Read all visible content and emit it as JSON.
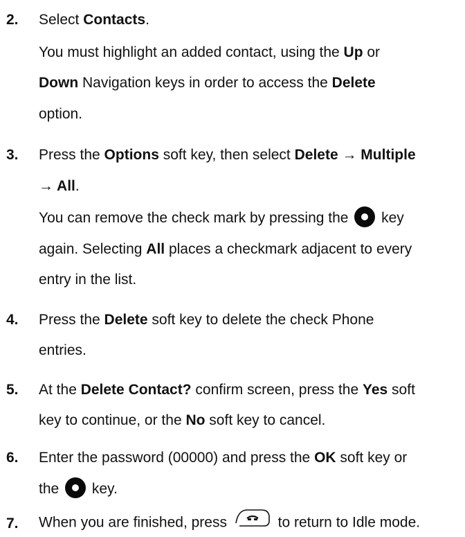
{
  "steps": [
    {
      "number": "2.",
      "lines": [
        [
          {
            "t": "Select "
          },
          {
            "t": "Contacts",
            "b": true
          },
          {
            "t": "."
          }
        ],
        [
          {
            "t": "You must highlight an added contact, using the "
          },
          {
            "t": "Up",
            "b": true
          },
          {
            "t": " or"
          }
        ],
        [
          {
            "t": "Down",
            "b": true
          },
          {
            "t": " Navigation keys in order to access the "
          },
          {
            "t": "Delete",
            "b": true
          }
        ],
        [
          {
            "t": "option."
          }
        ]
      ]
    },
    {
      "number": "3.",
      "lines": [
        [
          {
            "t": "Press the "
          },
          {
            "t": "Options",
            "b": true
          },
          {
            "t": " soft key, then select "
          },
          {
            "t": "Delete →  Multiple",
            "b": true
          }
        ],
        [
          {
            "t": "→ All",
            "b": true
          },
          {
            "t": "."
          }
        ],
        [
          {
            "t": "You can remove the check mark by pressing the "
          },
          {
            "icon": "ok-key-icon"
          },
          {
            "t": " key"
          }
        ],
        [
          {
            "t": "again. Selecting "
          },
          {
            "t": "All",
            "b": true
          },
          {
            "t": " places a checkmark adjacent to every"
          }
        ],
        [
          {
            "t": "entry in the list."
          }
        ]
      ]
    },
    {
      "number": "4.",
      "lines": [
        [
          {
            "t": "Press the "
          },
          {
            "t": "Delete",
            "b": true
          },
          {
            "t": " soft key to delete the check Phone"
          }
        ],
        [
          {
            "t": "entries."
          }
        ]
      ]
    },
    {
      "number": "5.",
      "lines": [
        [
          {
            "t": "At the "
          },
          {
            "t": "Delete Contact?",
            "b": true
          },
          {
            "t": " confirm screen, press the "
          },
          {
            "t": "Yes",
            "b": true
          },
          {
            "t": " soft"
          }
        ],
        [
          {
            "t": "key to continue, or the "
          },
          {
            "t": "No",
            "b": true
          },
          {
            "t": " soft key to cancel."
          }
        ]
      ]
    },
    {
      "number": "6.",
      "lines": [
        [
          {
            "t": "Enter the password (00000) and press the "
          },
          {
            "t": "OK",
            "b": true
          },
          {
            "t": " soft key or"
          }
        ],
        [
          {
            "t": "the "
          },
          {
            "icon": "ok-key-icon"
          },
          {
            "t": " key."
          }
        ]
      ]
    },
    {
      "number": "7.",
      "lines": [
        [
          {
            "t": "When you are finished, press "
          },
          {
            "icon": "end-key-icon"
          },
          {
            "t": " to return to Idle mode."
          }
        ]
      ]
    }
  ]
}
